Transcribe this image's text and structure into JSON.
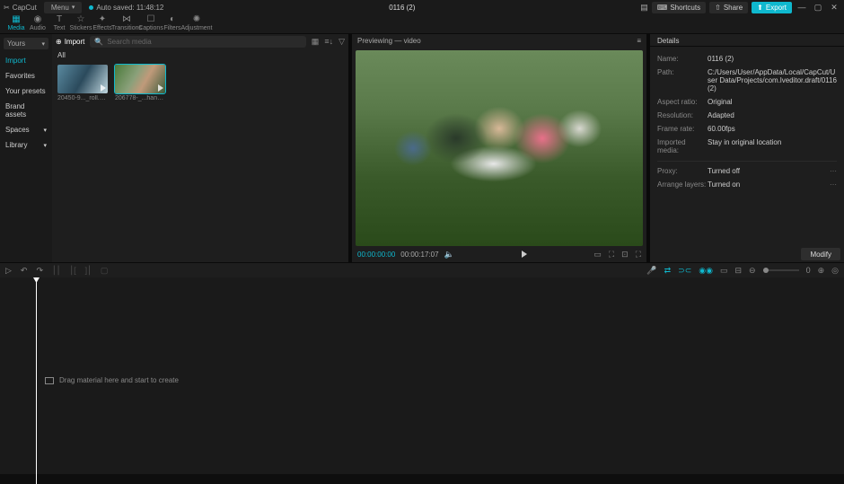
{
  "titlebar": {
    "app_name": "CapCut",
    "menu_label": "Menu",
    "autosave": "Auto saved: 11:48:12",
    "project_title": "0116 (2)",
    "shortcuts": "Shortcuts",
    "share": "Share",
    "export": "Export"
  },
  "tooltabs": [
    {
      "icon": "▦",
      "label": "Media"
    },
    {
      "icon": "◉",
      "label": "Audio"
    },
    {
      "icon": "T",
      "label": "Text"
    },
    {
      "icon": "☆",
      "label": "Stickers"
    },
    {
      "icon": "✦",
      "label": "Effects"
    },
    {
      "icon": "⋈",
      "label": "Transitions"
    },
    {
      "icon": "☐",
      "label": "Captions"
    },
    {
      "icon": "◐",
      "label": "Filters"
    },
    {
      "icon": "✺",
      "label": "Adjustment"
    }
  ],
  "media": {
    "selector": "Yours",
    "sidebar": [
      {
        "label": "Import",
        "active": true,
        "expand": false
      },
      {
        "label": "Favorites",
        "active": false,
        "expand": false
      },
      {
        "label": "Your presets",
        "active": false,
        "expand": false
      },
      {
        "label": "Brand assets",
        "active": false,
        "expand": false
      },
      {
        "label": "Spaces",
        "active": false,
        "expand": true
      },
      {
        "label": "Library",
        "active": false,
        "expand": true
      }
    ],
    "import_label": "Import",
    "search_placeholder": "Search media",
    "filter_all": "All",
    "thumbs": [
      {
        "name": "20450-9..._roll.mp4"
      },
      {
        "name": "206778-_...han.mp4"
      }
    ]
  },
  "preview": {
    "heading": "Previewing — video",
    "timecode_current": "00:00:00:00",
    "timecode_total": "00:00:17:07"
  },
  "details": {
    "heading": "Details",
    "rows": [
      {
        "label": "Name:",
        "value": "0116 (2)"
      },
      {
        "label": "Path:",
        "value": "C:/Users/User/AppData/Local/CapCut/User Data/Projects/com.lveditor.draft/0116  (2)"
      },
      {
        "label": "Aspect ratio:",
        "value": "Original"
      },
      {
        "label": "Resolution:",
        "value": "Adapted"
      },
      {
        "label": "Frame rate:",
        "value": "60.00fps"
      },
      {
        "label": "Imported media:",
        "value": "Stay in original location"
      }
    ],
    "rows2": [
      {
        "label": "Proxy:",
        "value": "Turned off"
      },
      {
        "label": "Arrange layers:",
        "value": "Turned on"
      }
    ],
    "modify": "Modify"
  },
  "timeline": {
    "zoom_value": "0",
    "drop_hint": "Drag material here and start to create"
  }
}
